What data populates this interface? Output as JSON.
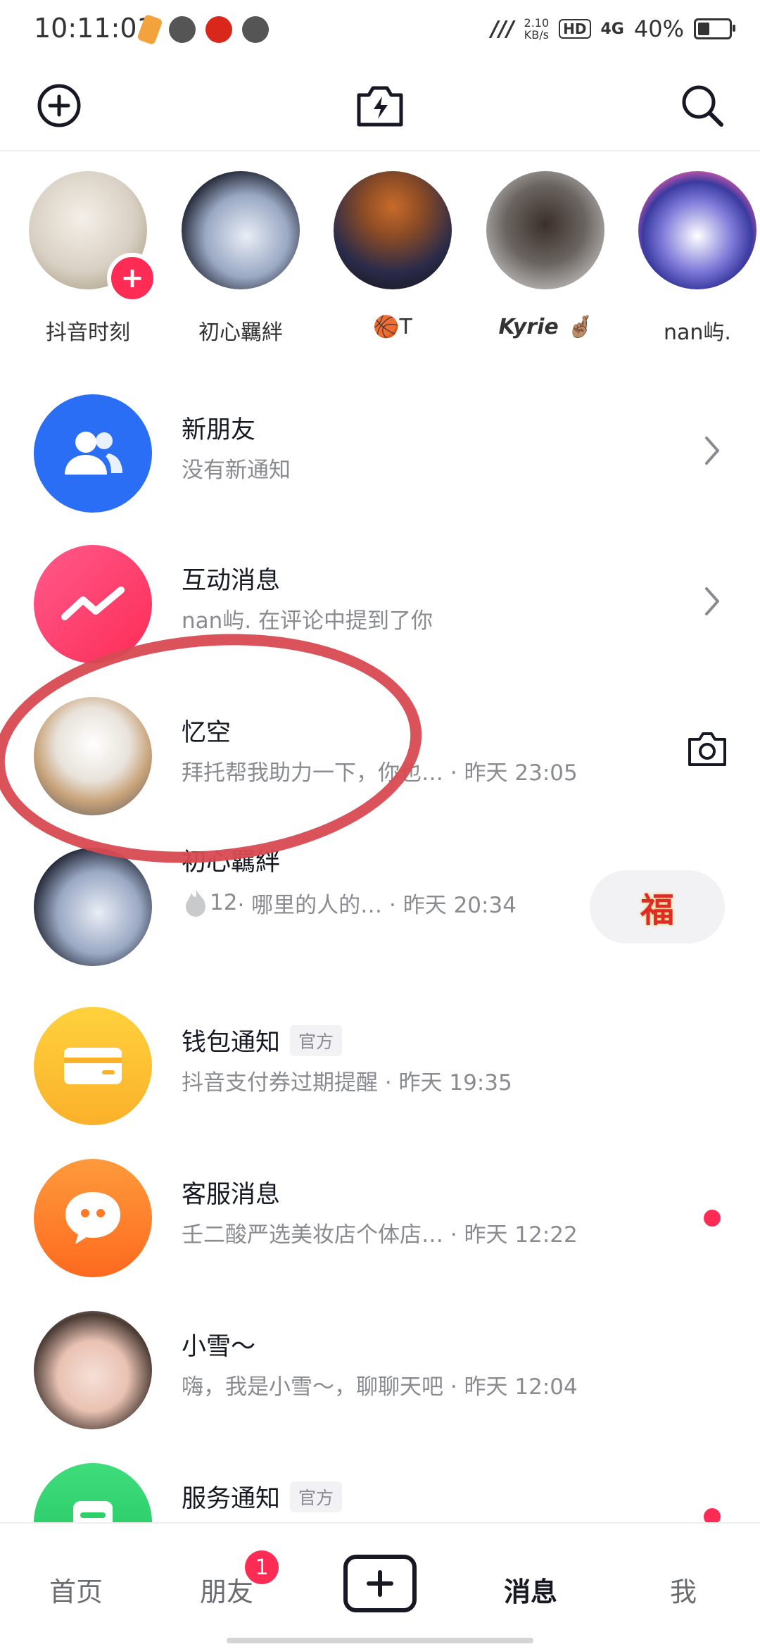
{
  "status_bar": {
    "time": "10:11:01",
    "net_speed": "2.10",
    "net_unit": "KB/s",
    "hd": "HD",
    "signal": "4G",
    "battery": "40%"
  },
  "stories": [
    {
      "name": "抖音时刻",
      "avatar": "cat-avatar"
    },
    {
      "name": "初心羈絆",
      "avatar": "anime-boy-avatar"
    },
    {
      "name": "🏀T",
      "avatar": "basketball-player-avatar"
    },
    {
      "name": "Kyrie 🤞🏽",
      "avatar": "kyrie-avatar"
    },
    {
      "name": "nan屿.",
      "avatar": "cartoon-wolf-avatar"
    }
  ],
  "messages": [
    {
      "title": "新朋友",
      "subtitle": "没有新通知"
    },
    {
      "title": "互动消息",
      "subtitle": "nan屿. 在评论中提到了你"
    },
    {
      "title": "忆空",
      "subtitle": "拜托帮我助力一下，你也…  · 昨天 23:05"
    },
    {
      "title": "初心羈絆",
      "streak": "12",
      "subtitle": " · 哪里的人的…   · 昨天 20:34",
      "fu": "福"
    },
    {
      "title": "钱包通知",
      "tag": "官方",
      "subtitle": "抖音支付券过期提醒 · 昨天 19:35"
    },
    {
      "title": "客服消息",
      "subtitle": "壬二酸严选美妆店个体店…  · 昨天 12:22"
    },
    {
      "title": "小雪～",
      "subtitle": "嗨，我是小雪～，聊聊天吧 · 昨天 12:04"
    },
    {
      "title": "服务通知",
      "tag": "官方"
    }
  ],
  "bottom_nav": {
    "home": "首页",
    "friends": "朋友",
    "friends_badge": "1",
    "messages": "消息",
    "me": "我"
  },
  "colors": {
    "accent": "#fe2c55",
    "new_friends_icon": "#2b6ef6",
    "interaction_icon": "#fe2c55",
    "wallet_icon": "#fdbf2b",
    "service_icon": "#fd7a28",
    "service_notice_icon": "#2fcf6a"
  }
}
